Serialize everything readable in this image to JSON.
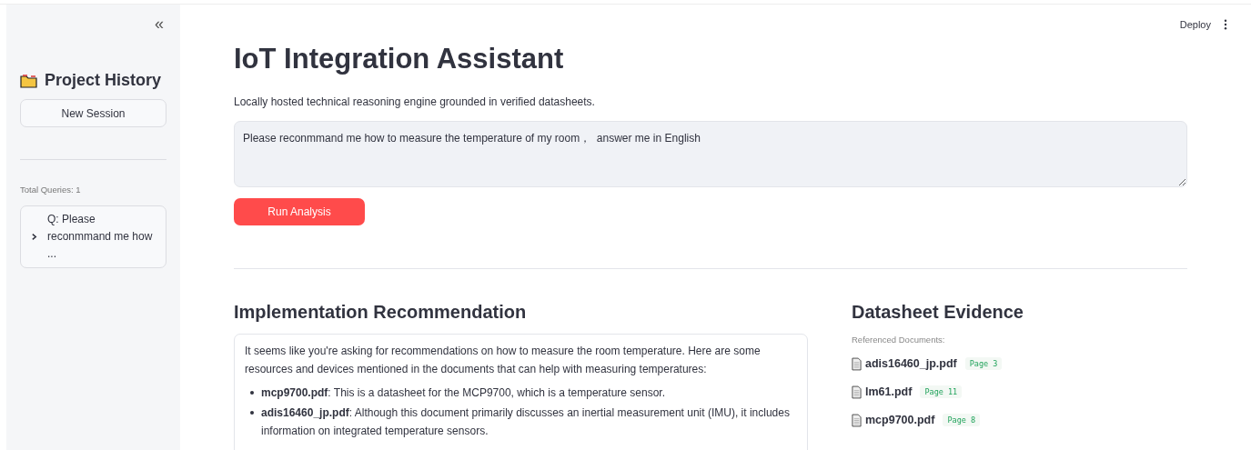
{
  "sidebar": {
    "collapse_icon": "«",
    "title": "Project History",
    "new_session_button": "New Session",
    "total_queries": "Total Queries: 1",
    "history": [
      {
        "label": "Q: Please reconmmand me how ...",
        "expanded": false
      }
    ]
  },
  "header": {
    "deploy_button": "Deploy"
  },
  "main": {
    "title": "IoT Integration Assistant",
    "subtitle": "Locally hosted technical reasoning engine grounded in verified datasheets.",
    "query_field": {
      "value": "Please reconmmand me how to measure the temperature of my room，  answer me in English"
    },
    "run_button": "Run Analysis"
  },
  "recommendation": {
    "heading": "Implementation Recommendation",
    "intro": "It seems like you're asking for recommendations on how to measure the room temperature. Here are some resources and devices mentioned in the documents that can help with measuring temperatures:",
    "bullets": [
      "**mcp9700.pdf**: This is a datasheet for the MCP9700, which is a temperature sensor.",
      "**adis16460_jp.pdf**: Although this document primarily discusses an inertial measurement unit (IMU), it includes information on integrated temperature sensors."
    ]
  },
  "evidence": {
    "heading": "Datasheet Evidence",
    "caption": "Referenced Documents:",
    "documents": [
      {
        "name": "adis16460_jp.pdf",
        "page": "Page 3"
      },
      {
        "name": "lm61.pdf",
        "page": "Page 11"
      },
      {
        "name": "mcp9700.pdf",
        "page": "Page 8"
      }
    ]
  }
}
